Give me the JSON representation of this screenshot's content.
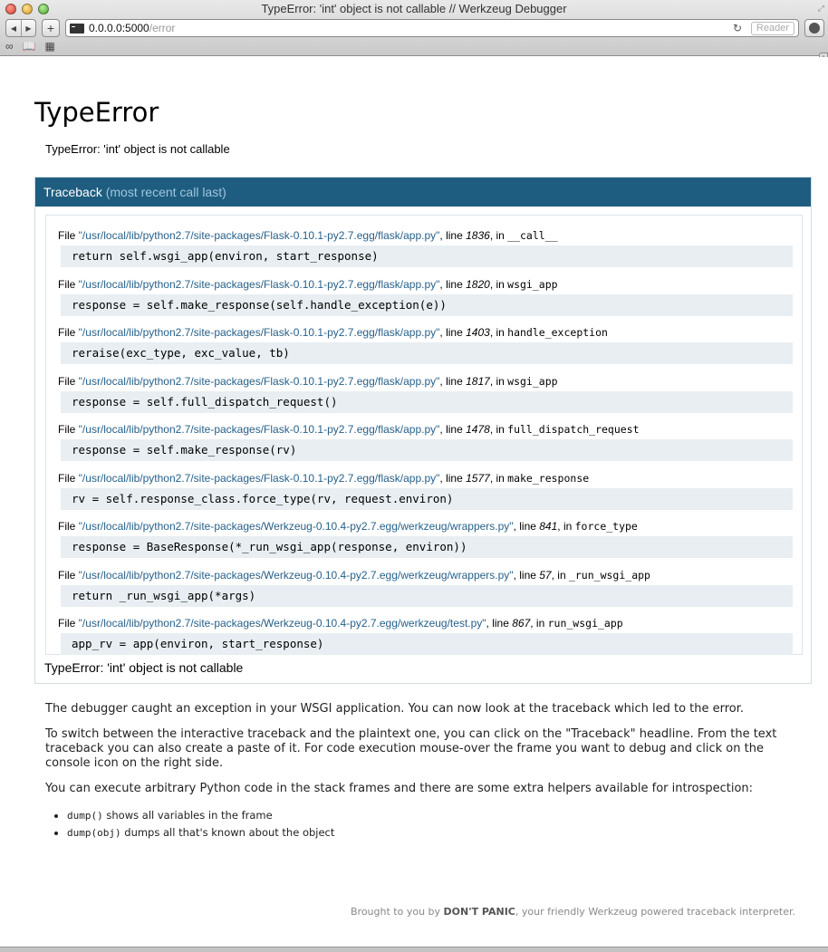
{
  "browser": {
    "window_title": "TypeError: 'int' object is not callable // Werkzeug Debugger",
    "url_host": "0.0.0.0:5000",
    "url_path": "/error",
    "reader_label": "Reader",
    "icons": [
      "back-icon",
      "forward-icon",
      "add-icon",
      "reload-icon",
      "downloads-icon",
      "reading-list-icon",
      "bookmarks-icon",
      "top-sites-icon"
    ]
  },
  "error": {
    "title": "TypeError",
    "message": "TypeError: 'int' object is not callable"
  },
  "traceback": {
    "header_title": "Traceback",
    "header_sub": "(most recent call last)",
    "file_prefix": "File ",
    "line_prefix": ", line ",
    "in_prefix": ", in ",
    "frames": [
      {
        "file": "\"/usr/local/lib/python2.7/site-packages/Flask-0.10.1-py2.7.egg/flask/app.py\"",
        "line": "1836",
        "func": "__call__",
        "source": "return self.wsgi_app(environ, start_response)"
      },
      {
        "file": "\"/usr/local/lib/python2.7/site-packages/Flask-0.10.1-py2.7.egg/flask/app.py\"",
        "line": "1820",
        "func": "wsgi_app",
        "source": "response = self.make_response(self.handle_exception(e))"
      },
      {
        "file": "\"/usr/local/lib/python2.7/site-packages/Flask-0.10.1-py2.7.egg/flask/app.py\"",
        "line": "1403",
        "func": "handle_exception",
        "source": "reraise(exc_type, exc_value, tb)"
      },
      {
        "file": "\"/usr/local/lib/python2.7/site-packages/Flask-0.10.1-py2.7.egg/flask/app.py\"",
        "line": "1817",
        "func": "wsgi_app",
        "source": "response = self.full_dispatch_request()"
      },
      {
        "file": "\"/usr/local/lib/python2.7/site-packages/Flask-0.10.1-py2.7.egg/flask/app.py\"",
        "line": "1478",
        "func": "full_dispatch_request",
        "source": "response = self.make_response(rv)"
      },
      {
        "file": "\"/usr/local/lib/python2.7/site-packages/Flask-0.10.1-py2.7.egg/flask/app.py\"",
        "line": "1577",
        "func": "make_response",
        "source": "rv = self.response_class.force_type(rv, request.environ)"
      },
      {
        "file": "\"/usr/local/lib/python2.7/site-packages/Werkzeug-0.10.4-py2.7.egg/werkzeug/wrappers.py\"",
        "line": "841",
        "func": "force_type",
        "source": "response = BaseResponse(*_run_wsgi_app(response, environ))"
      },
      {
        "file": "\"/usr/local/lib/python2.7/site-packages/Werkzeug-0.10.4-py2.7.egg/werkzeug/wrappers.py\"",
        "line": "57",
        "func": "_run_wsgi_app",
        "source": "return _run_wsgi_app(*args)"
      },
      {
        "file": "\"/usr/local/lib/python2.7/site-packages/Werkzeug-0.10.4-py2.7.egg/werkzeug/test.py\"",
        "line": "867",
        "func": "run_wsgi_app",
        "source": "app_rv = app(environ, start_response)"
      }
    ],
    "final_error": "TypeError: 'int' object is not callable"
  },
  "explanation": {
    "p1": "The debugger caught an exception in your WSGI application. You can now look at the traceback which led to the error.",
    "p2": "To switch between the interactive traceback and the plaintext one, you can click on the \"Traceback\" headline. From the text traceback you can also create a paste of it. For code execution mouse-over the frame you want to debug and click on the console icon on the right side.",
    "p3": "You can execute arbitrary Python code in the stack frames and there are some extra helpers available for introspection:",
    "helpers": [
      {
        "code": "dump()",
        "text": " shows all variables in the frame"
      },
      {
        "code": "dump(obj)",
        "text": " dumps all that's known about the object"
      }
    ]
  },
  "footer": {
    "prefix": "Brought to you by ",
    "brand": "DON'T PANIC",
    "suffix": ", your friendly Werkzeug powered traceback interpreter."
  },
  "colors": {
    "header_bg": "#1f5d80",
    "header_muted": "#9ec6df",
    "filename": "#27618a",
    "source_bg": "#e8eef1"
  }
}
